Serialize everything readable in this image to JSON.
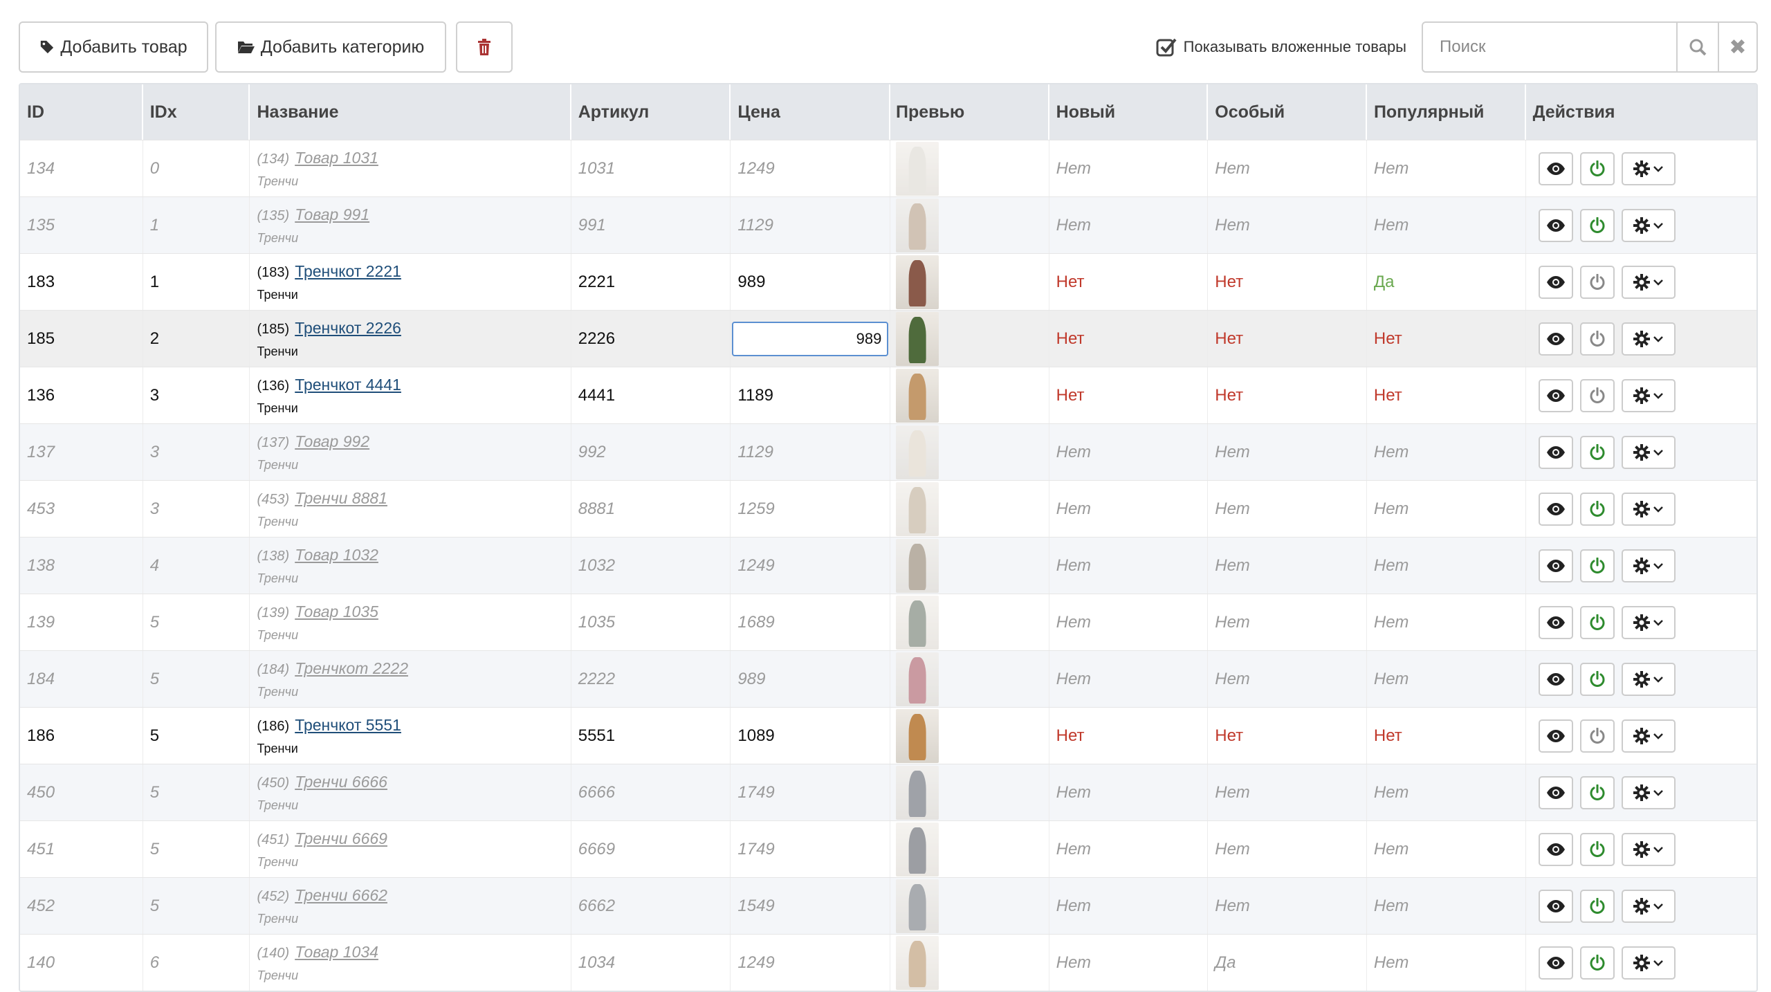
{
  "toolbar": {
    "add_product_label": "Добавить товар",
    "add_category_label": "Добавить категорию",
    "show_nested_label": "Показывать вложенные товары",
    "search_placeholder": "Поиск",
    "show_nested_checked": true
  },
  "table": {
    "headers": {
      "id": "ID",
      "idx": "IDx",
      "name": "Название",
      "sku": "Артикул",
      "price": "Цена",
      "preview": "Превью",
      "new": "Новый",
      "special": "Особый",
      "popular": "Популярный",
      "actions": "Действия"
    },
    "rows": [
      {
        "id": "134",
        "idx": "0",
        "name_id": "(134)",
        "name": "Товар 1031",
        "category": "Тренчи",
        "sku": "1031",
        "price": "1249",
        "new": "Нет",
        "special": "Нет",
        "popular": "Нет",
        "active": false,
        "thumb_color": "#d8d4cc"
      },
      {
        "id": "135",
        "idx": "1",
        "name_id": "(135)",
        "name": "Товар 991",
        "category": "Тренчи",
        "sku": "991",
        "price": "1129",
        "new": "Нет",
        "special": "Нет",
        "popular": "Нет",
        "active": false,
        "thumb_color": "#b59a7e"
      },
      {
        "id": "183",
        "idx": "1",
        "name_id": "(183)",
        "name": "Тренчкот 2221",
        "category": "Тренчи",
        "sku": "2221",
        "price": "989",
        "new": "Нет",
        "special": "Нет",
        "popular": "Да",
        "active": true,
        "thumb_color": "#8a5a4a"
      },
      {
        "id": "185",
        "idx": "2",
        "name_id": "(185)",
        "name": "Тренчкот 2226",
        "category": "Тренчи",
        "sku": "2226",
        "price": "989",
        "new": "Нет",
        "special": "Нет",
        "popular": "Нет",
        "active": true,
        "editing": true,
        "thumb_color": "#4f6b3c"
      },
      {
        "id": "136",
        "idx": "3",
        "name_id": "(136)",
        "name": "Тренчкот 4441",
        "category": "Тренчи",
        "sku": "4441",
        "price": "1189",
        "new": "Нет",
        "special": "Нет",
        "popular": "Нет",
        "active": true,
        "thumb_color": "#c49a6c"
      },
      {
        "id": "137",
        "idx": "3",
        "name_id": "(137)",
        "name": "Товар 992",
        "category": "Тренчи",
        "sku": "992",
        "price": "1129",
        "new": "Нет",
        "special": "Нет",
        "popular": "Нет",
        "active": false,
        "thumb_color": "#e2d6c4"
      },
      {
        "id": "453",
        "idx": "3",
        "name_id": "(453)",
        "name": "Тренчи 8881",
        "category": "Тренчи",
        "sku": "8881",
        "price": "1259",
        "new": "Нет",
        "special": "Нет",
        "popular": "Нет",
        "active": false,
        "thumb_color": "#b8a58c"
      },
      {
        "id": "138",
        "idx": "4",
        "name_id": "(138)",
        "name": "Товар 1032",
        "category": "Тренчи",
        "sku": "1032",
        "price": "1249",
        "new": "Нет",
        "special": "Нет",
        "popular": "Нет",
        "active": false,
        "thumb_color": "#8c7a62"
      },
      {
        "id": "139",
        "idx": "5",
        "name_id": "(139)",
        "name": "Товар 1035",
        "category": "Тренчи",
        "sku": "1035",
        "price": "1689",
        "new": "Нет",
        "special": "Нет",
        "popular": "Нет",
        "active": false,
        "thumb_color": "#5f6b5c"
      },
      {
        "id": "184",
        "idx": "5",
        "name_id": "(184)",
        "name": "Тренчкот 2222",
        "category": "Тренчи",
        "sku": "2222",
        "price": "989",
        "new": "Нет",
        "special": "Нет",
        "popular": "Нет",
        "active": false,
        "thumb_color": "#a8505a"
      },
      {
        "id": "186",
        "idx": "5",
        "name_id": "(186)",
        "name": "Тренчкот 5551",
        "category": "Тренчи",
        "sku": "5551",
        "price": "1089",
        "new": "Нет",
        "special": "Нет",
        "popular": "Нет",
        "active": true,
        "thumb_color": "#c08a50"
      },
      {
        "id": "450",
        "idx": "5",
        "name_id": "(450)",
        "name": "Тренчи 6666",
        "category": "Тренчи",
        "sku": "6666",
        "price": "1749",
        "new": "Нет",
        "special": "Нет",
        "popular": "Нет",
        "active": false,
        "thumb_color": "#5a5f66"
      },
      {
        "id": "451",
        "idx": "5",
        "name_id": "(451)",
        "name": "Тренчи 6669",
        "category": "Тренчи",
        "sku": "6669",
        "price": "1749",
        "new": "Нет",
        "special": "Нет",
        "popular": "Нет",
        "active": false,
        "thumb_color": "#4c5058"
      },
      {
        "id": "452",
        "idx": "5",
        "name_id": "(452)",
        "name": "Тренчи 6662",
        "category": "Тренчи",
        "sku": "6662",
        "price": "1549",
        "new": "Нет",
        "special": "Нет",
        "popular": "Нет",
        "active": false,
        "thumb_color": "#6c7076"
      },
      {
        "id": "140",
        "idx": "6",
        "name_id": "(140)",
        "name": "Товар 1034",
        "category": "Тренчи",
        "sku": "1034",
        "price": "1249",
        "new": "Нет",
        "special": "Да",
        "popular": "Нет",
        "active": false,
        "thumb_color": "#b08a5c"
      }
    ]
  },
  "colors": {
    "no_active": "#c0392b",
    "yes_active": "#6aa84f",
    "power_on": "#2e8b2e",
    "power_off": "#888888"
  }
}
